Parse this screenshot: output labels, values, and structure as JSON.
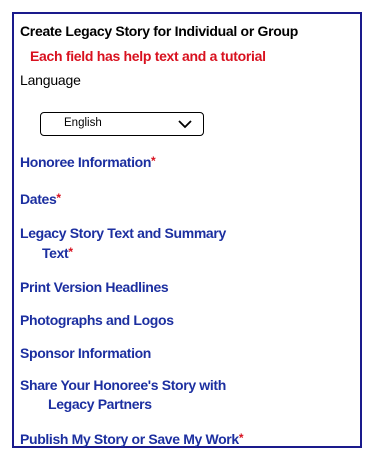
{
  "form": {
    "title": "Create Legacy Story for Individual  or Group",
    "help_text": "Each field has help text and a tutorial",
    "language_label": "Language",
    "language_value": "English",
    "required_mark": "*"
  },
  "nav": {
    "honoree": "Honoree Information",
    "dates": "Dates",
    "legacy_line1": "Legacy Story Text and Summary",
    "legacy_line2": "Text",
    "print": "Print Version Headlines",
    "photos": "Photographs and Logos",
    "sponsor": "Sponsor Information",
    "share_line1": "Share Your Honoree's Story with",
    "share_line2": "Legacy Partners",
    "publish": "Publish My Story or Save My Work"
  },
  "colors": {
    "border": "#1a1a8c",
    "link": "#1c2fa0",
    "required": "#d8111f"
  },
  "icons": {
    "select_arrow": "chevron-down-icon"
  }
}
